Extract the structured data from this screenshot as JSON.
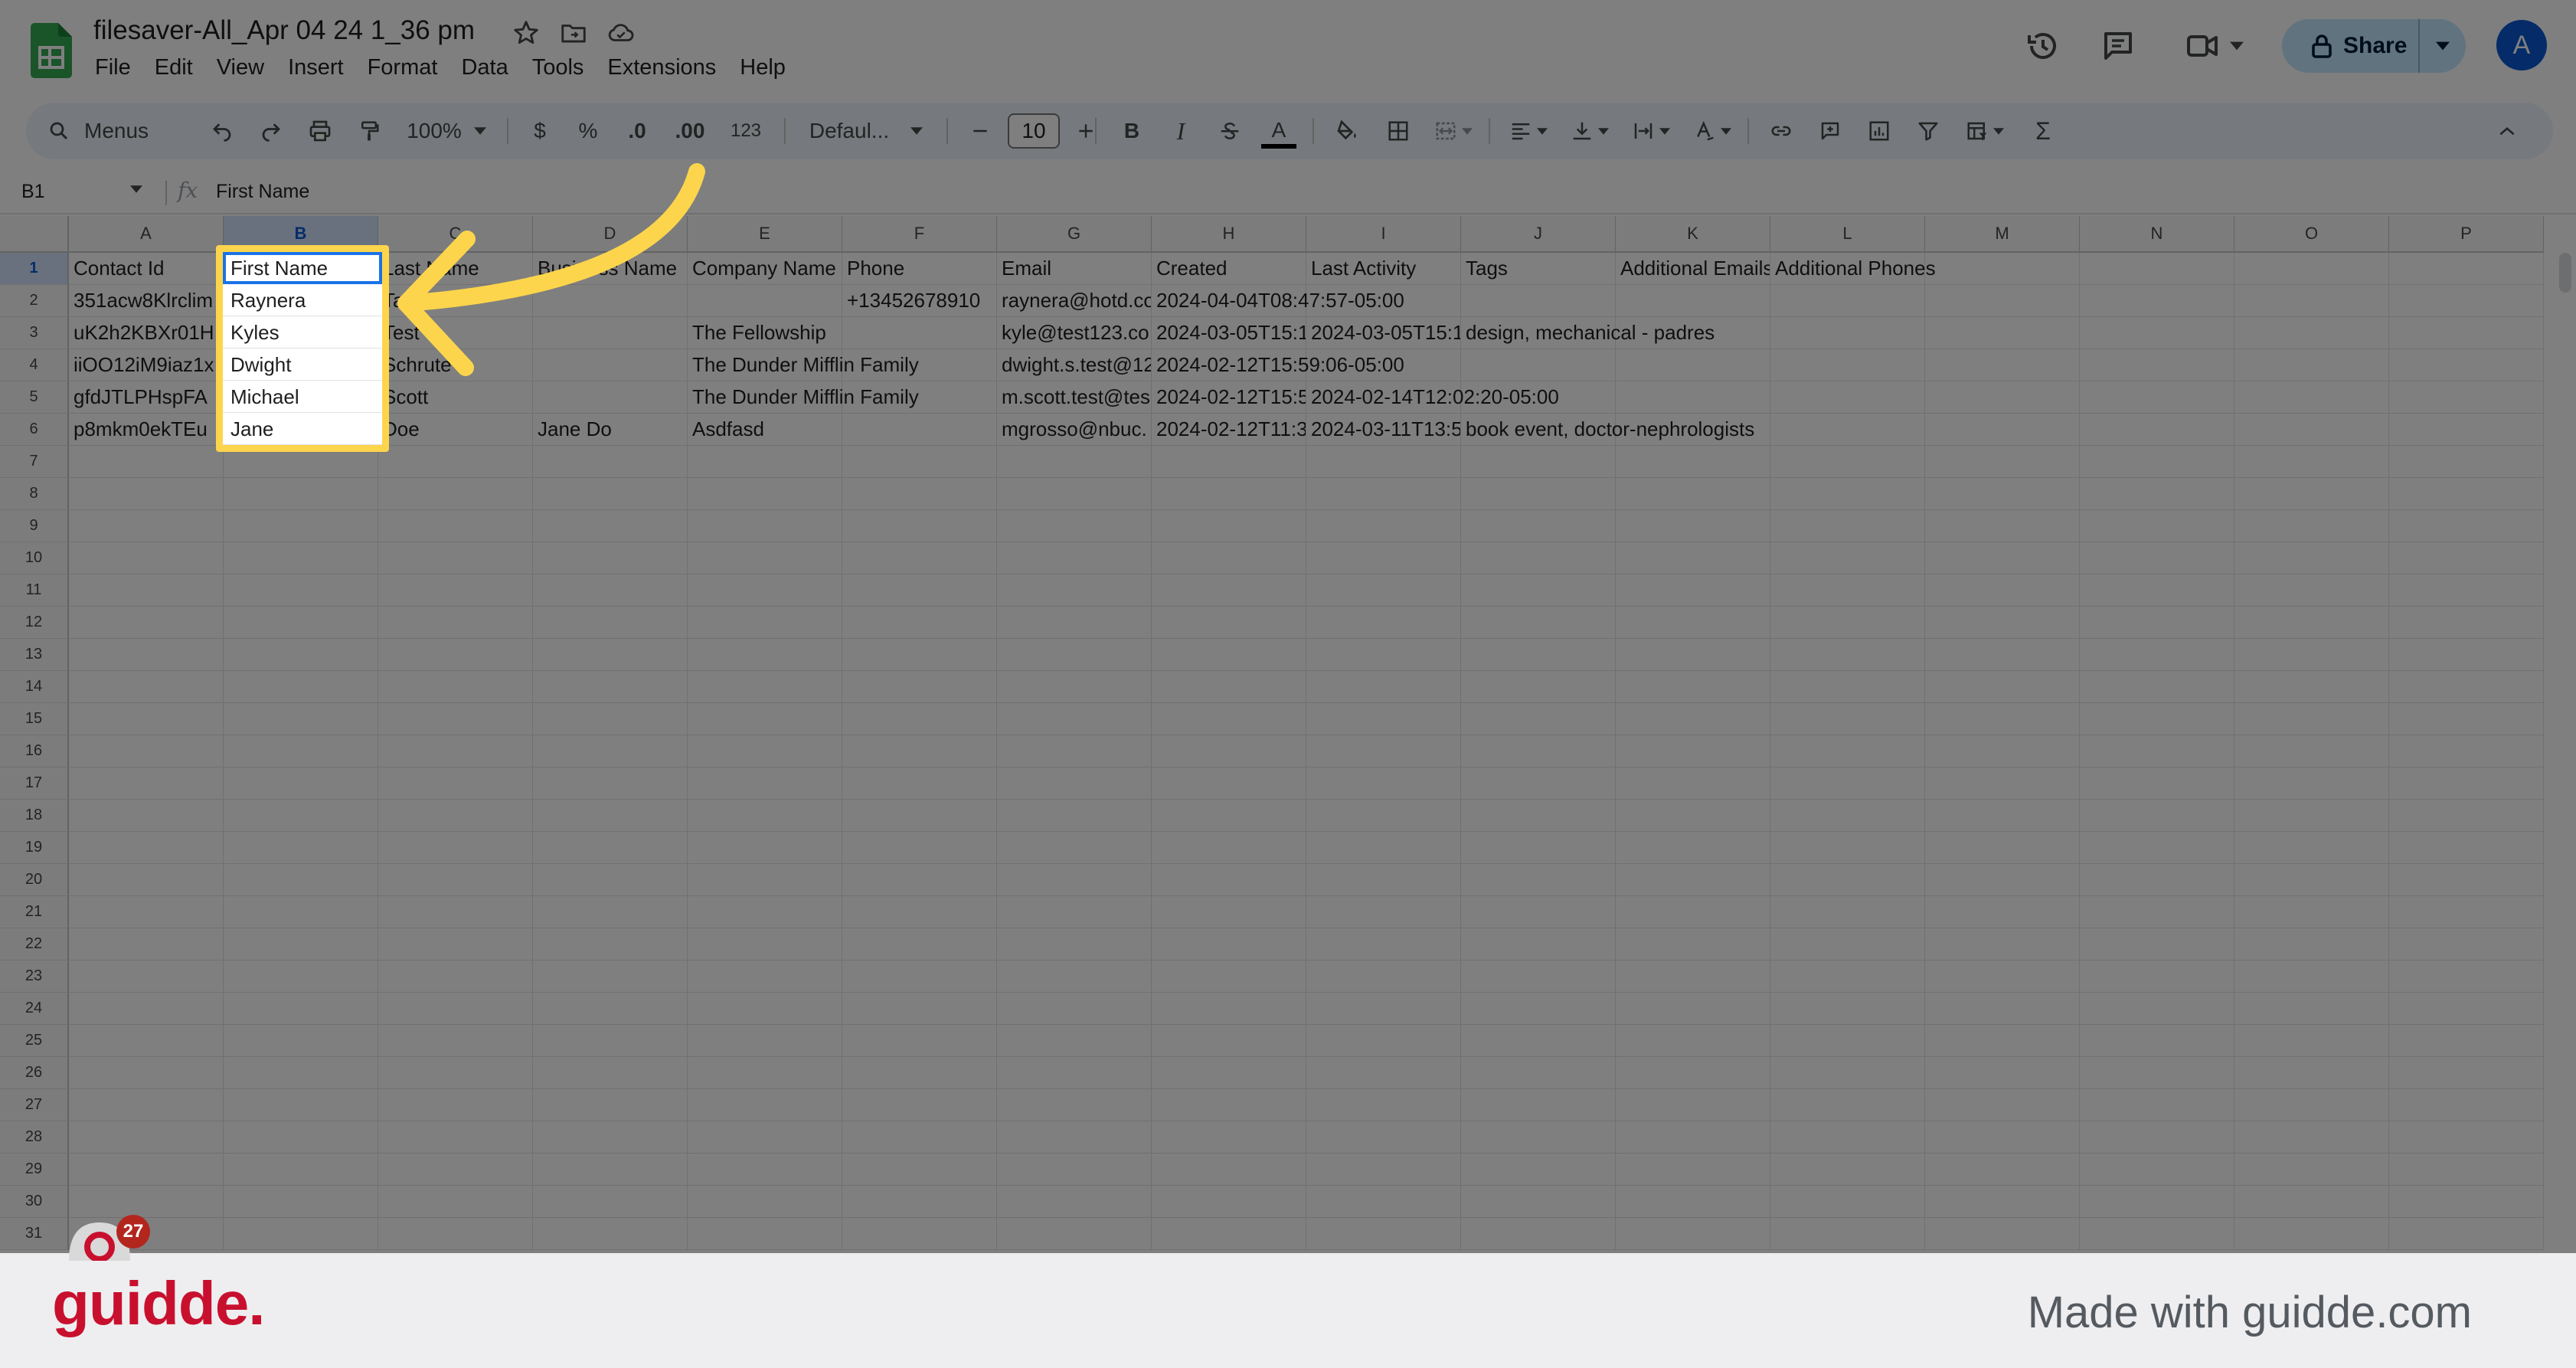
{
  "document": {
    "title": "filesaver-All_Apr 04 24 1_36 pm"
  },
  "menu": [
    "File",
    "Edit",
    "View",
    "Insert",
    "Format",
    "Data",
    "Tools",
    "Extensions",
    "Help"
  ],
  "header": {
    "share_label": "Share",
    "avatar_initial": "A"
  },
  "toolbar": {
    "menus_label": "Menus",
    "zoom": "100%",
    "currency": "$",
    "percent": "%",
    "dec_decrease": ".0",
    "dec_increase": ".00",
    "number_format": "123",
    "font": "Defaul...",
    "font_size": "10",
    "bold": "B",
    "italic": "I",
    "text_color": "A",
    "sum": "Σ"
  },
  "formula_bar": {
    "name_box": "B1",
    "fx": "fx",
    "content": "First Name"
  },
  "columns": [
    "A",
    "B",
    "C",
    "D",
    "E",
    "F",
    "G",
    "H",
    "I",
    "J",
    "K",
    "L",
    "M",
    "N",
    "O",
    "P"
  ],
  "row_numbers": [
    "1",
    "2",
    "3",
    "4",
    "5",
    "6",
    "7",
    "8",
    "9",
    "10",
    "11",
    "12",
    "13",
    "14",
    "15",
    "16",
    "17",
    "18",
    "19",
    "20",
    "21",
    "22",
    "23",
    "24",
    "25",
    "26",
    "27",
    "28",
    "29",
    "30",
    "31"
  ],
  "rows": [
    [
      "Contact Id",
      "First Name",
      "Last Name",
      "Business Name",
      "Company Name",
      "Phone",
      "Email",
      "Created",
      "Last Activity",
      "Tags",
      "Additional Emails",
      "Additional Phones"
    ],
    [
      "351acw8Klrclim",
      "Raynera",
      "Tarleton",
      "",
      "",
      "+13452678910",
      "raynera@hotd.co",
      "2024-04-04T08:47:57-05:00",
      "",
      "",
      "",
      ""
    ],
    [
      "uK2h2KBXr01H",
      "Kyles",
      "Test",
      "",
      "The Fellowship",
      "",
      "kyle@test123.co",
      "2024-03-05T15:1",
      "2024-03-05T15:1",
      "design, mechanical - padres",
      "",
      ""
    ],
    [
      "iiOO12iM9iaz1x",
      "Dwight",
      "Schrute",
      "",
      "The Dunder Mifflin Family",
      "",
      "dwight.s.test@12",
      "2024-02-12T15:59:06-05:00",
      "",
      "",
      "",
      ""
    ],
    [
      "gfdJTLPHspFA",
      "Michael",
      "Scott",
      "",
      "The Dunder Mifflin Family",
      "",
      "m.scott.test@tes",
      "2024-02-12T15:5",
      "2024-02-14T12:02:20-05:00",
      "",
      "",
      ""
    ],
    [
      "p8mkm0ekTEu",
      "Jane",
      "Doe",
      "Jane Do",
      "Asdfasd",
      "",
      "mgrosso@nbuc.",
      "2024-02-12T11:3",
      "2024-03-11T13:5",
      "book event, doctor-nephrologists",
      "",
      ""
    ]
  ],
  "highlight_column": [
    "First Name",
    "Raynera",
    "Kyles",
    "Dwight",
    "Michael",
    "Jane"
  ],
  "badge": {
    "count": "27"
  },
  "footer": {
    "brand": "guidde.",
    "tagline": "Made with guidde.com"
  },
  "colors": {
    "accent_yellow": "#fdd54c",
    "selection_blue": "#1a73e8",
    "share_bg": "#c2e7ff",
    "brand_red": "#c8102e"
  }
}
